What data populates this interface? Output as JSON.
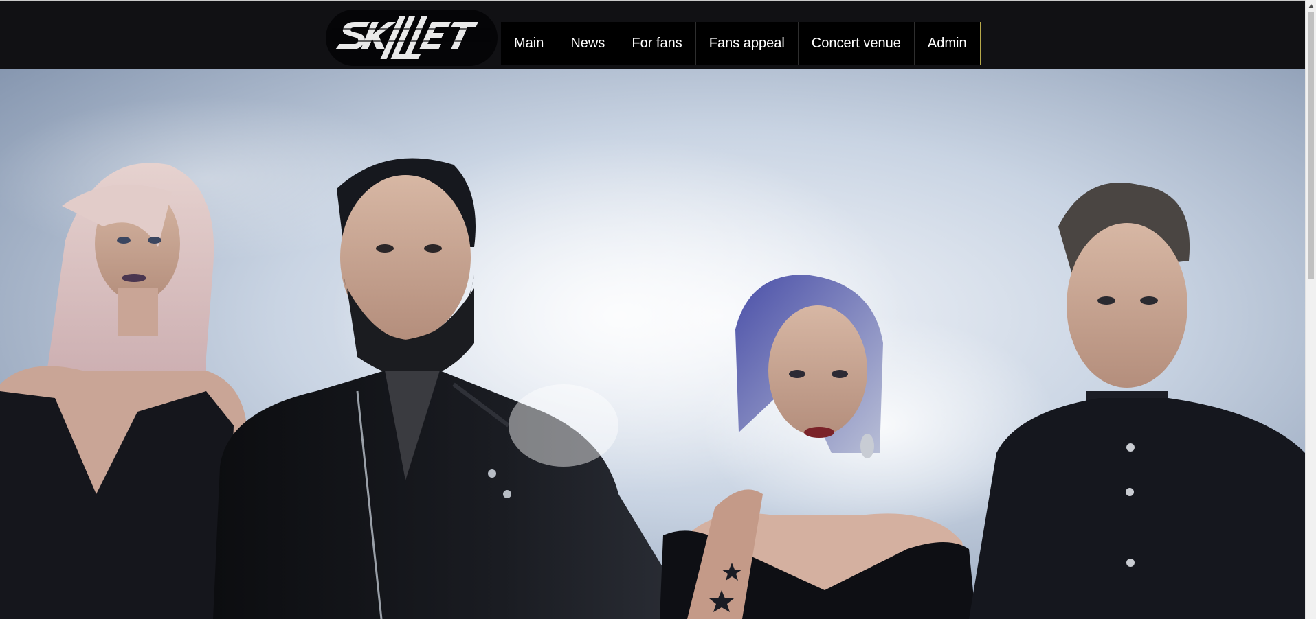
{
  "brand": {
    "logo_text": "SKILLET"
  },
  "nav": {
    "items": [
      {
        "label": "Main"
      },
      {
        "label": "News"
      },
      {
        "label": "For fans"
      },
      {
        "label": "Fans appeal"
      },
      {
        "label": "Concert venue"
      },
      {
        "label": "Admin"
      }
    ]
  },
  "hero": {
    "image": "band-photo",
    "colors": {
      "sky": "#c7d3e3",
      "mist": "#eef2f7",
      "clothing": "#12151c"
    }
  },
  "colors": {
    "header_bg": "#111114",
    "nav_bg": "#000000",
    "nav_text": "#ffffff",
    "nav_accent": "#b7a84a"
  },
  "icons": {
    "scroll_up": "triangle-up-icon"
  }
}
